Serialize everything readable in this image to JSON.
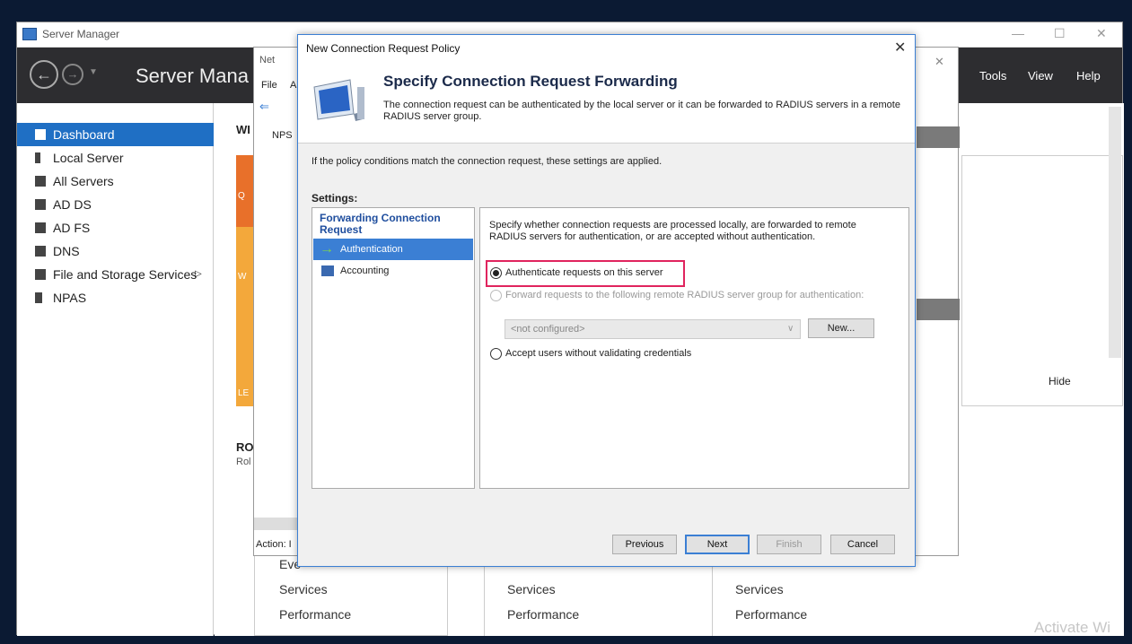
{
  "server_manager": {
    "window_title": "Server Manager",
    "app_title": "Server Mana",
    "menu": [
      "Tools",
      "View",
      "Help"
    ],
    "sidebar": [
      {
        "label": "Dashboard",
        "active": true
      },
      {
        "label": "Local Server",
        "active": false
      },
      {
        "label": "All Servers",
        "active": false
      },
      {
        "label": "AD DS",
        "active": false
      },
      {
        "label": "AD FS",
        "active": false
      },
      {
        "label": "DNS",
        "active": false
      },
      {
        "label": "File and Storage Services",
        "active": false
      },
      {
        "label": "NPAS",
        "active": false
      }
    ],
    "background": {
      "hide_label": "Hide",
      "ro_label": "RO",
      "rol_label": "Rol",
      "col1": [
        "Eve",
        "Services",
        "Performance"
      ],
      "col2": [
        "Services",
        "Performance"
      ],
      "col3": [
        "Services",
        "Performance"
      ],
      "action_label": "Action: I",
      "nps_title": "Net",
      "nps_menu_file": "File",
      "nps_menu_a": "A",
      "nps_root": "NPS",
      "side_letters": [
        "WI",
        "Q",
        "W",
        "LE"
      ]
    }
  },
  "dialog": {
    "title": "New Connection Request Policy",
    "heading": "Specify Connection Request Forwarding",
    "description": "The connection request can be authenticated by the local server or it can be forwarded to RADIUS servers in a remote RADIUS server group.",
    "info": "If the policy conditions match the connection request, these settings are applied.",
    "settings_label": "Settings:",
    "left_panel": {
      "heading": "Forwarding Connection Request",
      "items": [
        {
          "label": "Authentication",
          "selected": true
        },
        {
          "label": "Accounting",
          "selected": false
        }
      ]
    },
    "right_panel": {
      "description": "Specify whether connection requests are processed locally, are forwarded to remote RADIUS servers for authentication, or are accepted without authentication.",
      "options": [
        {
          "label": "Authenticate requests on this server",
          "checked": true,
          "enabled": true
        },
        {
          "label": "Forward requests to the following remote RADIUS server group for authentication:",
          "checked": false,
          "enabled": false
        },
        {
          "label": "Accept users without validating credentials",
          "checked": false,
          "enabled": true
        }
      ],
      "server_group_value": "<not configured>",
      "new_button": "New..."
    },
    "buttons": {
      "previous": "Previous",
      "next": "Next",
      "finish": "Finish",
      "cancel": "Cancel"
    }
  },
  "watermark": "Activate Wi",
  "colors": {
    "accent": "#3b7fd4",
    "highlight": "#e0245e",
    "header_bg": "#2d2d30"
  }
}
